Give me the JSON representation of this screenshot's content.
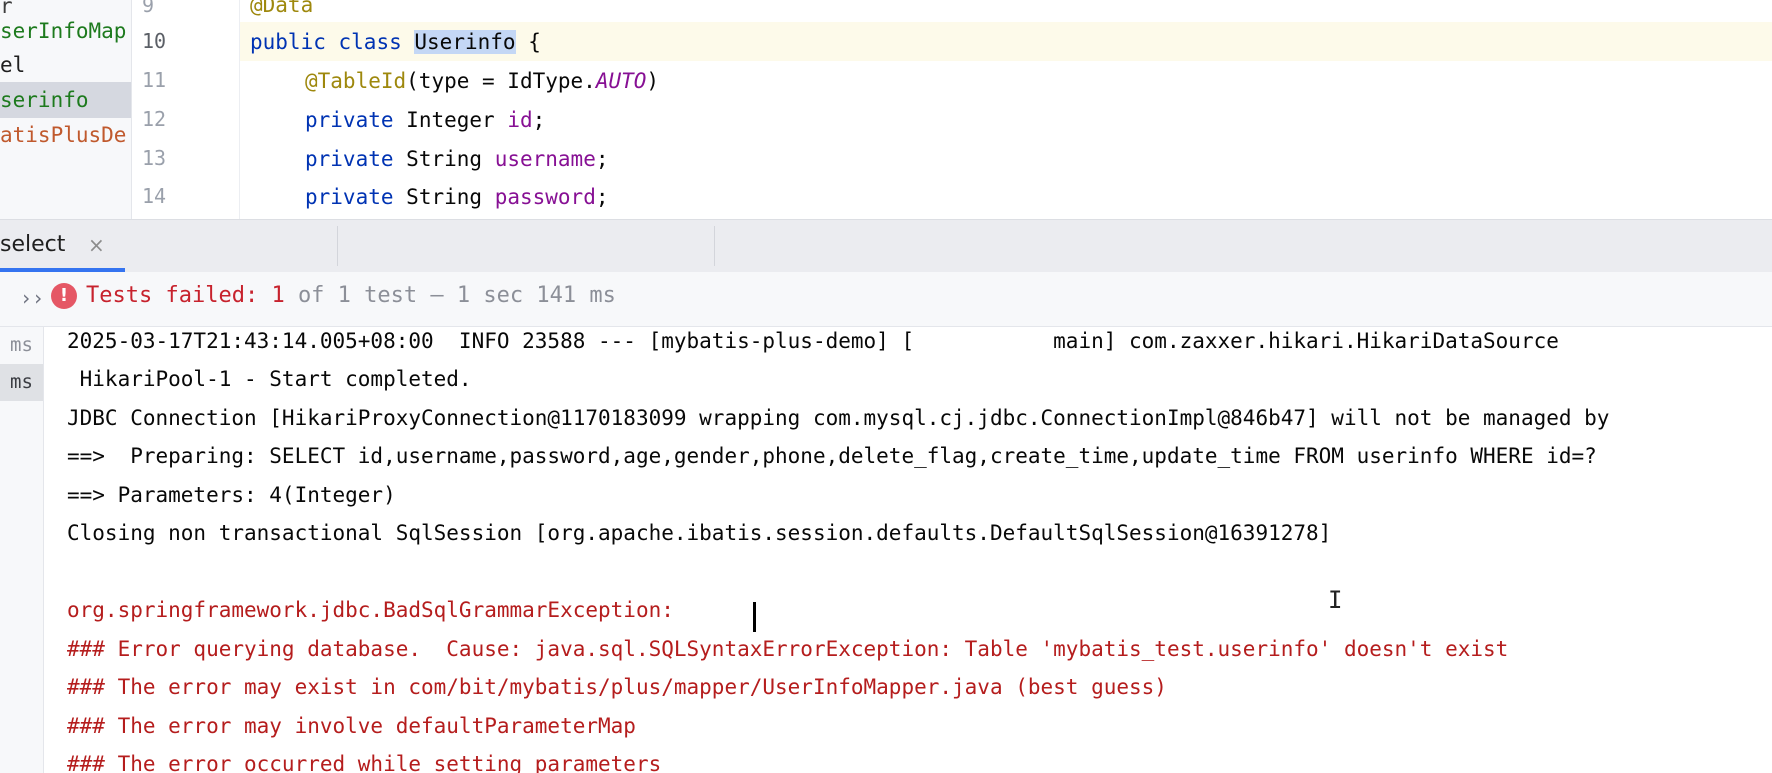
{
  "project_tree": {
    "items": [
      {
        "label": "r",
        "color": "#3d3d3d"
      },
      {
        "label": "serInfoMap",
        "color": "#1d7a1d"
      },
      {
        "label": "el",
        "color": "#1f1f1f"
      },
      {
        "label": "serinfo",
        "color": "#1d7a1d",
        "selected": true
      },
      {
        "label": "atisPlusDe",
        "color": "#c0592d"
      }
    ]
  },
  "editor": {
    "line_numbers": [
      "9",
      "10",
      "11",
      "12",
      "13",
      "14"
    ],
    "current_line": "10",
    "code": {
      "l9": {
        "annotation": "@Data"
      },
      "l10": {
        "kw1": "public",
        "kw2": "class",
        "classname": "Userinfo",
        "brace": "{"
      },
      "l11": {
        "annotation": "@TableId",
        "open": "(type = IdType.",
        "const": "AUTO",
        "close": ")"
      },
      "l12": {
        "kw": "private",
        "type": "Integer",
        "field": "id",
        "end": ";"
      },
      "l13": {
        "kw": "private",
        "type": "String",
        "field": "username",
        "end": ";"
      },
      "l14": {
        "kw": "private",
        "type": "String",
        "field": "password",
        "end": ";"
      }
    }
  },
  "run_window": {
    "tab_label": "select",
    "tab_close": "×",
    "status": {
      "chevron": "››",
      "fail_icon": "!",
      "failed_label": "Tests failed:",
      "failed_count": "1",
      "of_text": "of 1 test – 1 sec 141 ms"
    },
    "tree": {
      "rows": [
        {
          "label": "ms",
          "selected": false
        },
        {
          "label": "ms",
          "selected": true
        }
      ]
    },
    "console": {
      "lines": [
        {
          "text": "2025-03-17T21:43:14.005+08:00  INFO 23588 --- [mybatis-plus-demo] [           main] com.zaxxer.hikari.HikariDataSource",
          "type": "normal"
        },
        {
          "text": " HikariPool-1 - Start completed.",
          "type": "normal"
        },
        {
          "text": "JDBC Connection [HikariProxyConnection@1170183099 wrapping com.mysql.cj.jdbc.ConnectionImpl@846b47] will not be managed by",
          "type": "normal"
        },
        {
          "text": "==>  Preparing: SELECT id,username,password,age,gender,phone,delete_flag,create_time,update_time FROM userinfo WHERE id=?",
          "type": "normal"
        },
        {
          "text": "==> Parameters: 4(Integer)",
          "type": "normal"
        },
        {
          "text": "Closing non transactional SqlSession [org.apache.ibatis.session.defaults.DefaultSqlSession@16391278]",
          "type": "normal"
        },
        {
          "text": "",
          "type": "normal"
        },
        {
          "text": "org.springframework.jdbc.BadSqlGrammarException: ",
          "type": "error"
        },
        {
          "text": "### Error querying database.  Cause: java.sql.SQLSyntaxErrorException: Table 'mybatis_test.userinfo' doesn't exist",
          "type": "error"
        },
        {
          "text": "### The error may exist in com/bit/mybatis/plus/mapper/UserInfoMapper.java (best guess)",
          "type": "error"
        },
        {
          "text": "### The error may involve defaultParameterMap",
          "type": "error"
        },
        {
          "text": "### The error occurred while setting parameters",
          "type": "error"
        }
      ]
    }
  },
  "colors": {
    "keyword": "#0033b3",
    "annotation": "#9e880d",
    "field": "#871094",
    "error_text": "#b51d1d",
    "failed_status": "#c7222d",
    "tab_accent": "#3574f0",
    "selection": "#c4d7f5"
  }
}
